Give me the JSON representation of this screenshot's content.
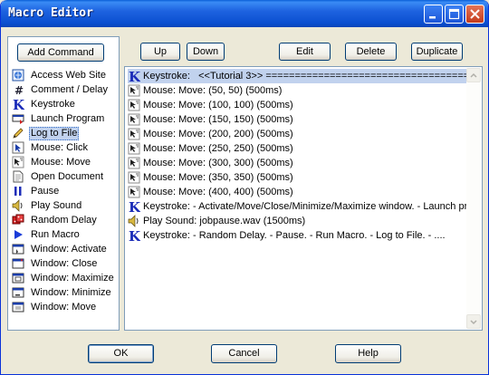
{
  "window": {
    "title": "Macro Editor"
  },
  "left_panel": {
    "add_label": "Add Command",
    "commands": [
      {
        "label": "Access Web Site",
        "icon": "web-site-icon"
      },
      {
        "label": "Comment / Delay",
        "icon": "hash-icon"
      },
      {
        "label": "Keystroke",
        "icon": "keystroke-k-icon"
      },
      {
        "label": "Launch Program",
        "icon": "launch-icon"
      },
      {
        "label": "Log to File",
        "icon": "pencil-icon"
      },
      {
        "label": "Mouse: Click",
        "icon": "mouse-click-icon"
      },
      {
        "label": "Mouse: Move",
        "icon": "mouse-move-icon"
      },
      {
        "label": "Open Document",
        "icon": "document-icon"
      },
      {
        "label": "Pause",
        "icon": "pause-icon"
      },
      {
        "label": "Play Sound",
        "icon": "speaker-icon"
      },
      {
        "label": "Random Delay",
        "icon": "dice-icon"
      },
      {
        "label": "Run Macro",
        "icon": "play-arrow-icon"
      },
      {
        "label": "Window: Activate",
        "icon": "window-activate-icon"
      },
      {
        "label": "Window: Close",
        "icon": "window-close-icon"
      },
      {
        "label": "Window: Maximize",
        "icon": "window-maximize-icon"
      },
      {
        "label": "Window: Minimize",
        "icon": "window-minimize-icon"
      },
      {
        "label": "Window: Move",
        "icon": "window-move-icon"
      }
    ],
    "selected": "Log to File"
  },
  "toolbar": {
    "up_label": "Up",
    "down_label": "Down",
    "edit_label": "Edit",
    "delete_label": "Delete",
    "duplicate_label": "Duplicate"
  },
  "script": [
    {
      "text": "Keystroke:   <<Tutorial 3>> ========================================",
      "icon": "keystroke-k-icon"
    },
    {
      "text": "Mouse: Move: (50, 50) (500ms)",
      "icon": "mouse-move-icon"
    },
    {
      "text": "Mouse: Move: (100, 100) (500ms)",
      "icon": "mouse-move-icon"
    },
    {
      "text": "Mouse: Move: (150, 150) (500ms)",
      "icon": "mouse-move-icon"
    },
    {
      "text": "Mouse: Move: (200, 200) (500ms)",
      "icon": "mouse-move-icon"
    },
    {
      "text": "Mouse: Move: (250, 250) (500ms)",
      "icon": "mouse-move-icon"
    },
    {
      "text": "Mouse: Move: (300, 300) (500ms)",
      "icon": "mouse-move-icon"
    },
    {
      "text": "Mouse: Move: (350, 350) (500ms)",
      "icon": "mouse-move-icon"
    },
    {
      "text": "Mouse: Move: (400, 400) (500ms)",
      "icon": "mouse-move-icon"
    },
    {
      "text": "Keystroke: - Activate/Move/Close/Minimize/Maximize window. - Launch pr",
      "icon": "keystroke-k-icon"
    },
    {
      "text": "Play Sound: jobpause.wav (1500ms)",
      "icon": "speaker-icon"
    },
    {
      "text": "Keystroke: - Random Delay. - Pause. - Run Macro. - Log to File. - ....",
      "icon": "keystroke-k-icon"
    }
  ],
  "footer": {
    "ok_label": "OK",
    "cancel_label": "Cancel",
    "help_label": "Help"
  }
}
